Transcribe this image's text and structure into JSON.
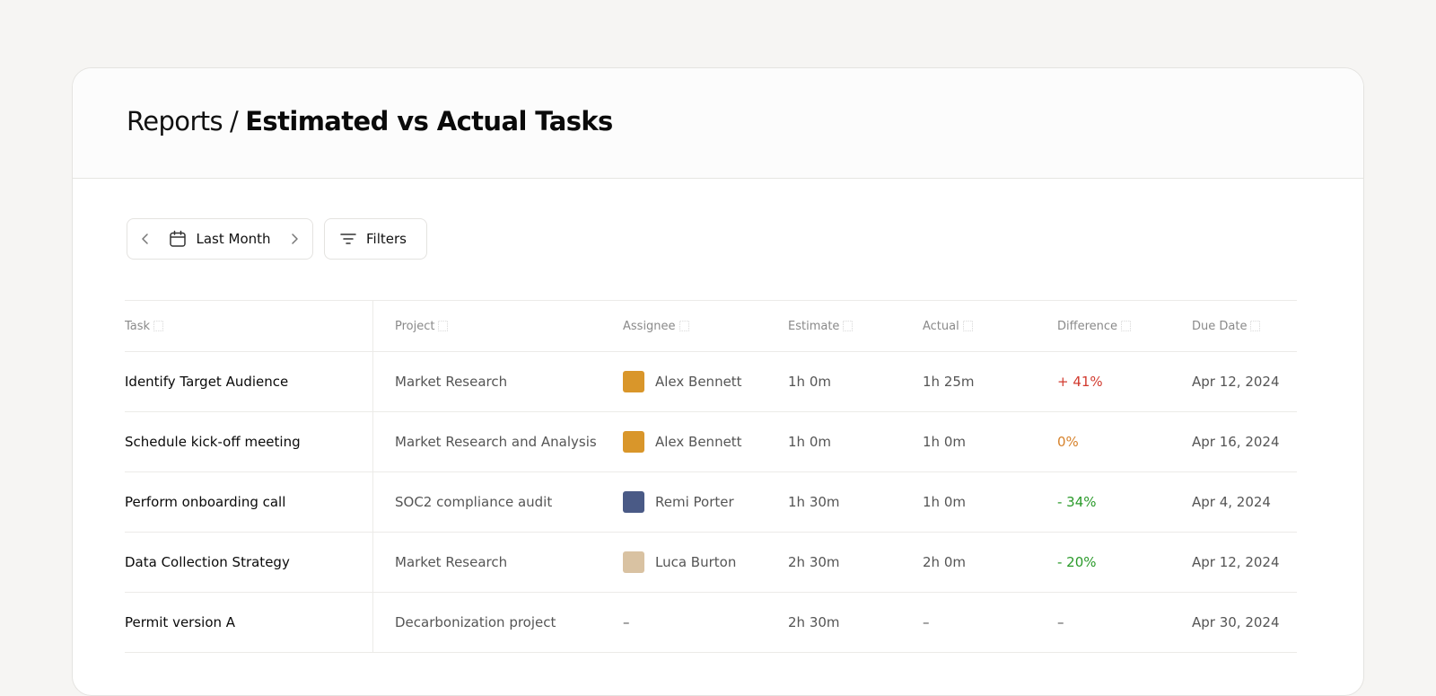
{
  "header": {
    "parent": "Reports",
    "separator": "/",
    "current": "Estimated vs Actual Tasks"
  },
  "toolbar": {
    "date_range": "Last Month",
    "filters_label": "Filters"
  },
  "icons": {
    "prev": "chevron-left-icon",
    "calendar": "calendar-icon",
    "next": "chevron-right-icon",
    "filters": "filter-icon",
    "sort": "sort-icon"
  },
  "colors": {
    "over": "#d23b2f",
    "neutral": "#d6822c",
    "under": "#2a9a2a"
  },
  "table": {
    "columns": [
      "Task",
      "Project",
      "Assignee",
      "Estimate",
      "Actual",
      "Difference",
      "Due Date"
    ],
    "rows": [
      {
        "task": "Identify Target Audience",
        "project": "Market Research",
        "assignee": "Alex Bennett",
        "avatar_color": "#d9962a",
        "estimate": "1h 0m",
        "actual": "1h 25m",
        "difference": "+ 41%",
        "diff_status": "over",
        "due_date": "Apr 12, 2024"
      },
      {
        "task": "Schedule kick-off meeting",
        "project": "Market Research and Analysis",
        "assignee": "Alex Bennett",
        "avatar_color": "#d9962a",
        "estimate": "1h 0m",
        "actual": "1h 0m",
        "difference": "0%",
        "diff_status": "neutral",
        "due_date": "Apr 16, 2024"
      },
      {
        "task": "Perform onboarding call",
        "project": "SOC2 compliance audit",
        "assignee": "Remi Porter",
        "avatar_color": "#4a5a86",
        "estimate": "1h 30m",
        "actual": "1h 0m",
        "difference": "- 34%",
        "diff_status": "under",
        "due_date": "Apr 4, 2024"
      },
      {
        "task": "Data Collection Strategy",
        "project": "Market Research",
        "assignee": "Luca Burton",
        "avatar_color": "#d9c2a2",
        "estimate": "2h 30m",
        "actual": "2h 0m",
        "difference": "- 20%",
        "diff_status": "under",
        "due_date": "Apr 12, 2024"
      },
      {
        "task": "Permit version A",
        "project": "Decarbonization project",
        "assignee": "–",
        "avatar_color": "",
        "estimate": "2h 30m",
        "actual": "–",
        "difference": "–",
        "diff_status": "none",
        "due_date": "Apr 30, 2024"
      }
    ]
  }
}
